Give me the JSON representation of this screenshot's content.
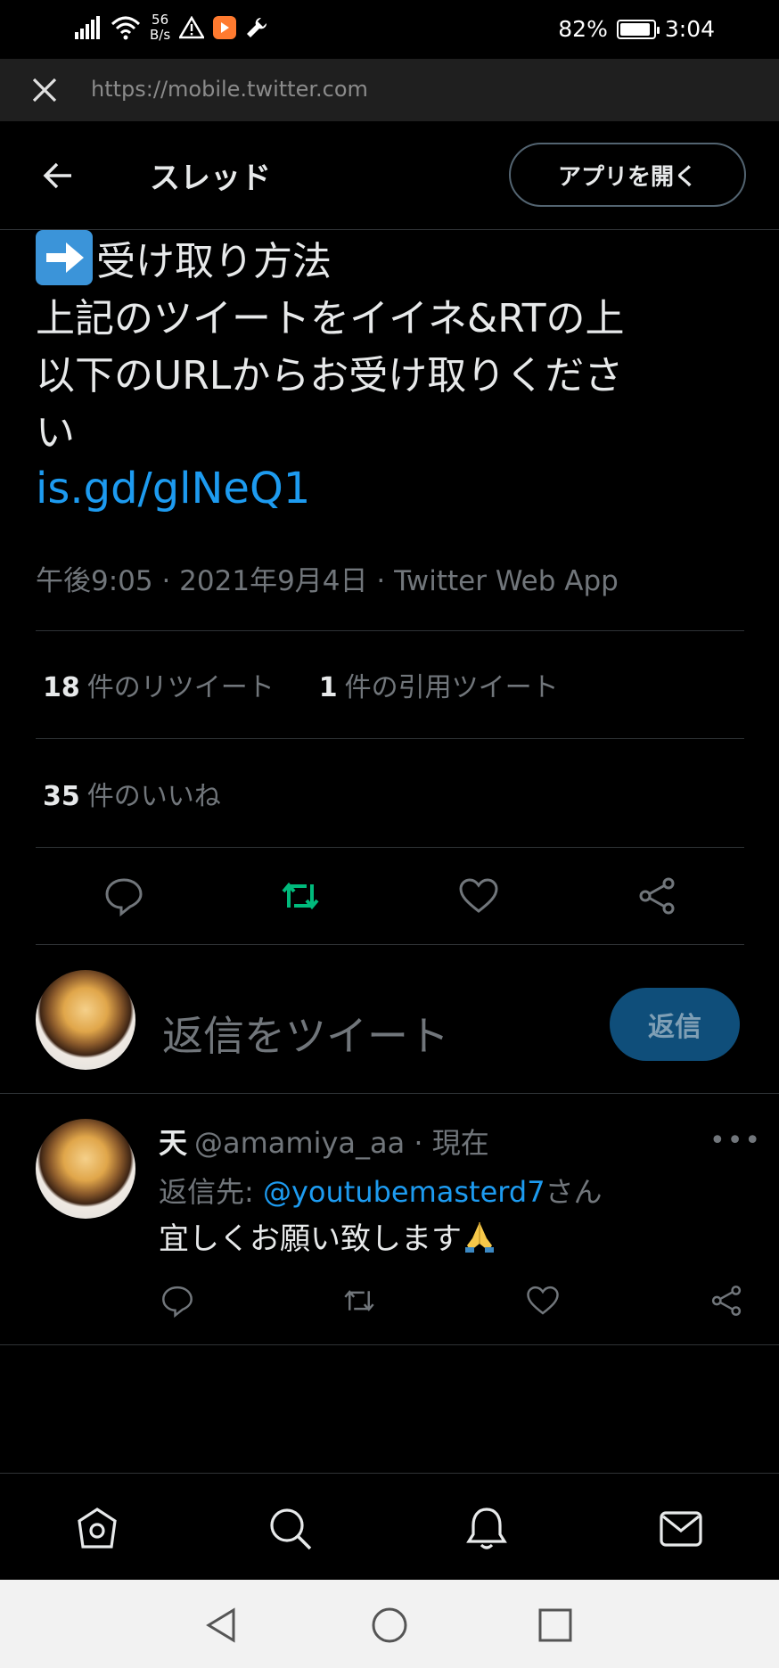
{
  "status_bar": {
    "net_speed_value": "56",
    "net_speed_unit": "B/s",
    "battery": "82%",
    "time": "3:04"
  },
  "browser": {
    "url": "https://mobile.twitter.com",
    "icons": [
      "close-icon"
    ]
  },
  "header": {
    "title": "スレッド",
    "open_app_label": "アプリを開く"
  },
  "tweet": {
    "line1": "受け取り方法",
    "line2": "上記のツイートをイイネ&RTの上",
    "line3": "以下のURLからお受け取りくださ",
    "line4": "い",
    "link": "is.gd/glNeQ1",
    "meta": "午後9:05 · 2021年9月4日 · Twitter Web App",
    "retweet_count": "18",
    "retweet_label": "件のリツイート",
    "quote_count": "1",
    "quote_label": "件の引用ツイート",
    "like_count": "35",
    "like_label": "件のいいね"
  },
  "composer": {
    "placeholder": "返信をツイート",
    "reply_label": "返信"
  },
  "reply": {
    "name": "天",
    "handle": "@amamiya_aa",
    "dot": "·",
    "time": "現在",
    "replying_prefix": "返信先: ",
    "replying_mention": "@youtubemasterd7",
    "replying_suffix": "さん",
    "text": "宜しくお願い致します",
    "more": "•••"
  },
  "colors": {
    "accent": "#1d9bf0",
    "retweet_active": "#00ba7c",
    "muted": "#71767b",
    "divider": "#2f3336"
  }
}
